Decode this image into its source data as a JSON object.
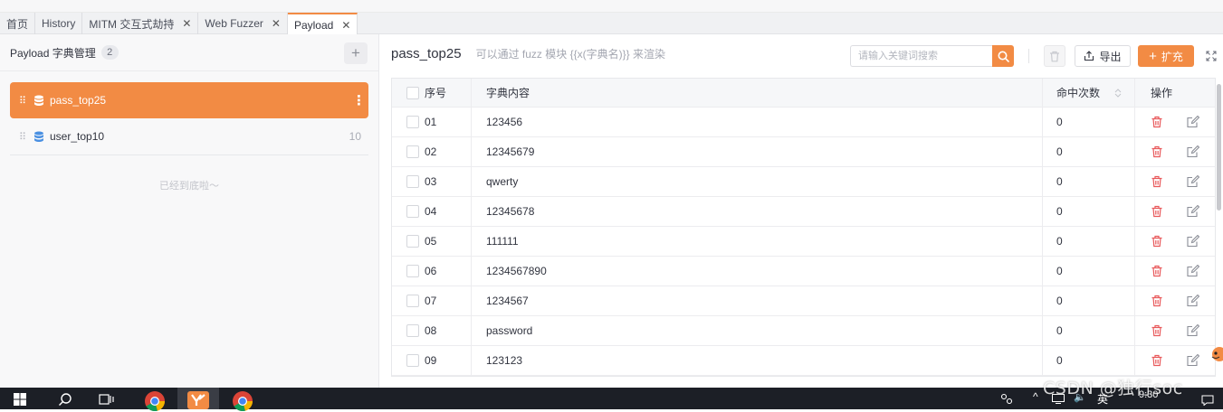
{
  "tabs": [
    {
      "label": "首页",
      "closable": false,
      "active": false
    },
    {
      "label": "History",
      "closable": false,
      "active": false
    },
    {
      "label": "MITM 交互式劫持",
      "closable": true,
      "active": false
    },
    {
      "label": "Web Fuzzer",
      "closable": true,
      "active": false
    },
    {
      "label": "Payload",
      "closable": true,
      "active": true
    }
  ],
  "sidebar": {
    "title": "Payload 字典管理",
    "count": "2",
    "items": [
      {
        "name": "pass_top25",
        "count": "",
        "active": true
      },
      {
        "name": "user_top10",
        "count": "10",
        "active": false
      }
    ],
    "end_text": "已经到底啦～"
  },
  "main": {
    "title": "pass_top25",
    "hint": "可以通过 fuzz 模块 {{x(字典名)}} 来渲染",
    "search_placeholder": "请输入关键词搜索",
    "export_label": "导出",
    "expand_label": "扩充"
  },
  "table": {
    "columns": {
      "no": "序号",
      "value": "字典内容",
      "hits": "命中次数",
      "ops": "操作"
    },
    "rows": [
      {
        "no": "01",
        "value": "123456",
        "hits": "0"
      },
      {
        "no": "02",
        "value": "12345679",
        "hits": "0"
      },
      {
        "no": "03",
        "value": "qwerty",
        "hits": "0"
      },
      {
        "no": "04",
        "value": "12345678",
        "hits": "0"
      },
      {
        "no": "05",
        "value": "111111",
        "hits": "0"
      },
      {
        "no": "06",
        "value": "1234567890",
        "hits": "0"
      },
      {
        "no": "07",
        "value": "1234567",
        "hits": "0"
      },
      {
        "no": "08",
        "value": "password",
        "hits": "0"
      },
      {
        "no": "09",
        "value": "123123",
        "hits": "0"
      }
    ]
  },
  "taskbar": {
    "ime": "英",
    "time": "9:30"
  },
  "watermark": "CSDN @独行soc",
  "colors": {
    "accent": "#f28b44",
    "delete": "#e8585a",
    "db_icon": "#4a90e2"
  },
  "icons": {
    "drag": "drag-handle-icon",
    "database": "database-icon",
    "more": "more-vertical-icon",
    "search": "search-icon",
    "delete": "trash-icon",
    "edit": "edit-icon",
    "export": "export-icon",
    "fullscreen": "fullscreen-icon"
  }
}
